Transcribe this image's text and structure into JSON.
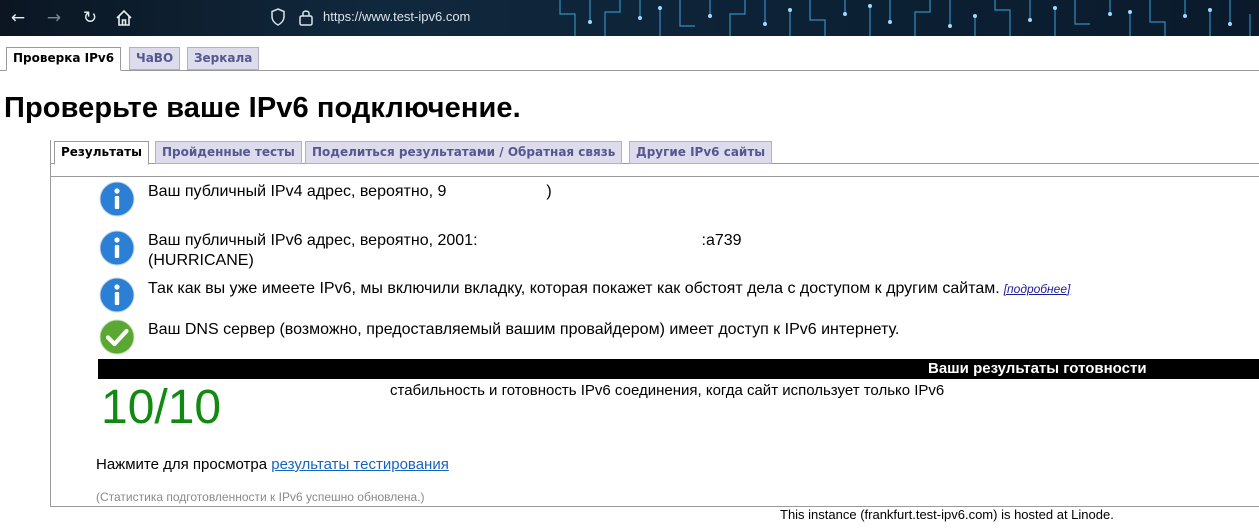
{
  "browser": {
    "url": "https://www.test-ipv6.com",
    "icons": [
      "back-arrow-icon",
      "forward-arrow-icon",
      "refresh-icon",
      "home-icon",
      "shield-icon",
      "lock-icon"
    ]
  },
  "top_tabs": [
    {
      "label": "Проверка IPv6",
      "active": true
    },
    {
      "label": "ЧаВО",
      "active": false
    },
    {
      "label": "Зеркала",
      "active": false
    }
  ],
  "page_title": "Проверьте ваше IPv6 подключение.",
  "sub_tabs": [
    {
      "label": "Результаты",
      "active": true
    },
    {
      "label": "Пройденные тесты",
      "active": false
    },
    {
      "label": "Поделиться результатами / Обратная связь",
      "active": false
    },
    {
      "label": "Другие IPv6 сайты",
      "active": false
    }
  ],
  "messages": {
    "ipv4": {
      "icon": "info-icon",
      "text": "Ваш публичный IPv4 адрес, вероятно, ",
      "start": "9",
      "end": ")"
    },
    "ipv6": {
      "icon": "info-icon",
      "text": "Ваш публичный IPv6 адрес, вероятно, 2001:",
      "end": ":a739",
      "line2": "(HURRICANE)"
    },
    "tab_info": {
      "icon": "info-icon",
      "text": "Так как вы уже имеете IPv6, мы включили вкладку, которая покажет как обстоят дела с доступом к другим сайтам.",
      "link": "[подробнее]"
    },
    "dns": {
      "icon": "checkmark-icon",
      "text": "Ваш DNS сервер (возможно, предоставляемый вашим провайдером) имеет доступ к IPv6 интернету."
    }
  },
  "readiness": {
    "title": "Ваши результаты готовности",
    "score": "10/10",
    "description": "стабильность и готовность IPv6 соединения, когда сайт использует только IPv6"
  },
  "view_prefix": "Нажмите для просмотра ",
  "view_link": "результаты тестирования",
  "stats_note": "(Статистика подготовленности к IPv6 успешно обновлена.)",
  "hosted_note": "This instance (frankfurt.test-ipv6.com) is hosted at Linode.",
  "colors": {
    "score": "#118a11",
    "link": "#1565c0",
    "info_icon": "#2b7fd4",
    "check_icon": "#5aa832"
  }
}
